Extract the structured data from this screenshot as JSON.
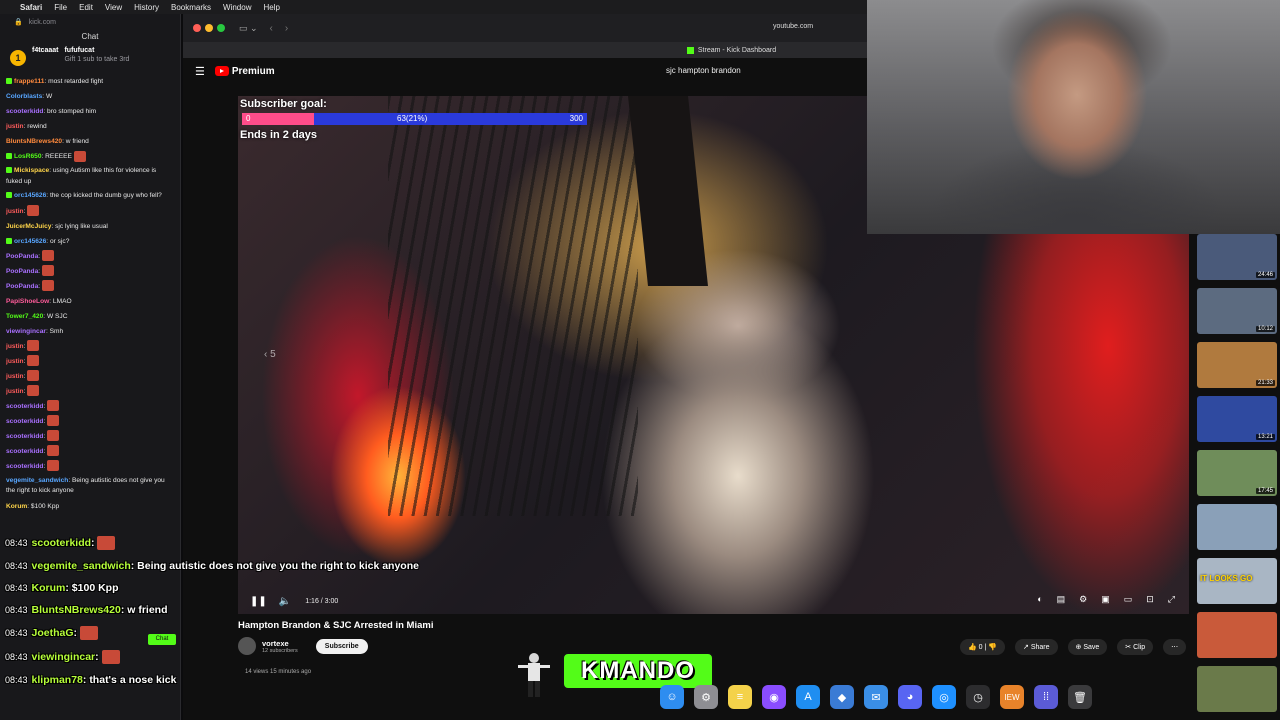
{
  "menubar": {
    "app": "Safari",
    "items": [
      "File",
      "Edit",
      "View",
      "History",
      "Bookmarks",
      "Window",
      "Help"
    ]
  },
  "chat": {
    "url": "kick.com",
    "title": "Chat",
    "gift": {
      "user": "f4tcaaat",
      "badge_user": "fufufucat",
      "count": "1",
      "note": "Gift 1 sub to take 3rd"
    },
    "messages": [
      {
        "user": "frappe111",
        "text": "most retarded fight",
        "color": "#ff8a3d",
        "badge": true
      },
      {
        "user": "Colorblasts",
        "text": "W",
        "color": "#58a6ff"
      },
      {
        "user": "scooterkidd",
        "text": "bro stomped him",
        "color": "#a970ff"
      },
      {
        "user": "justin",
        "text": "rewind",
        "color": "#ff5c5c"
      },
      {
        "user": "BluntsNBrews420",
        "text": "w friend",
        "color": "#ff8a3d"
      },
      {
        "user": "LosR650",
        "text": "REEEEE",
        "color": "#53fc18",
        "badge": true,
        "emote": true
      },
      {
        "user": "Mickispace",
        "text": "using Autism like this for violence is fuked up",
        "color": "#ffd54a",
        "badge": true,
        "two": true
      },
      {
        "user": "orc145626",
        "text": "the cop kicked the dumb guy who fell?",
        "color": "#58a6ff",
        "badge": true,
        "two": true
      },
      {
        "user": "justin",
        "text": "",
        "color": "#ff5c5c",
        "emote": true
      },
      {
        "user": "JuicerMcJuicy",
        "text": "sjc lying like usual",
        "color": "#ffd54a"
      },
      {
        "user": "orc145626",
        "text": "or sjc?",
        "color": "#58a6ff",
        "badge": true
      },
      {
        "user": "PooPanda",
        "text": "",
        "color": "#a970ff",
        "emote": true
      },
      {
        "user": "PooPanda",
        "text": "",
        "color": "#a970ff",
        "emote": true
      },
      {
        "user": "PooPanda",
        "text": "",
        "color": "#a970ff",
        "emote": true
      },
      {
        "user": "PapiShoeLow",
        "text": "LMAO",
        "color": "#ff5c9a"
      },
      {
        "user": "Tower7_420",
        "text": "W SJC",
        "color": "#53fc18"
      },
      {
        "user": "viewingincar",
        "text": "Smh",
        "color": "#a970ff"
      },
      {
        "user": "justin",
        "text": "",
        "color": "#ff5c5c",
        "emote": true
      },
      {
        "user": "justin",
        "text": "",
        "color": "#ff5c5c",
        "emote": true
      },
      {
        "user": "justin",
        "text": "",
        "color": "#ff5c5c",
        "emote": true
      },
      {
        "user": "justin",
        "text": "",
        "color": "#ff5c5c",
        "emote": true
      },
      {
        "user": "scooterkidd",
        "text": "",
        "color": "#a970ff",
        "emote": true
      },
      {
        "user": "scooterkidd",
        "text": "",
        "color": "#a970ff",
        "emote": true
      },
      {
        "user": "scooterkidd",
        "text": "",
        "color": "#a970ff",
        "emote": true
      },
      {
        "user": "scooterkidd",
        "text": "",
        "color": "#a970ff",
        "emote": true
      },
      {
        "user": "scooterkidd",
        "text": "",
        "color": "#a970ff",
        "emote": true
      },
      {
        "user": "vegemite_sandwich",
        "text": "Being autistic does not give you the right to kick anyone",
        "color": "#58a6ff",
        "two": true
      },
      {
        "user": "Korum",
        "text": "$100 Kpp",
        "color": "#ffd54a"
      }
    ]
  },
  "browser": {
    "url": "youtube.com",
    "tab_title": "Stream - Kick Dashboard",
    "yt_brand": "Premium",
    "search_query": "sjc hampton brandon"
  },
  "video": {
    "goal": {
      "title": "Subscriber goal:",
      "min": "0",
      "current": "63(21%)",
      "max": "300",
      "fill_fraction": 0.21,
      "ends": "Ends in 2 days"
    },
    "seek_hint": "‹ 5",
    "time": "1:16 / 3:00",
    "progress_fraction": 0.422,
    "title": "Hampton Brandon & SJC Arrested in Miami",
    "channel": "vortexe",
    "subscribers": "12 subscribers",
    "subscribe_label": "Subscribe",
    "likes": "0",
    "share": "Share",
    "save": "Save",
    "clip": "Clip",
    "views": "14 views  15 minutes ago"
  },
  "sidebar_thumbs": [
    {
      "dur": "24:46",
      "color": "#4a5a7a"
    },
    {
      "dur": "10:12",
      "color": "#5c6b80"
    },
    {
      "dur": "21:33",
      "color": "#b07a3e"
    },
    {
      "dur": "13:21",
      "color": "#2f4aa0"
    },
    {
      "dur": "17:45",
      "color": "#6f8d5a"
    },
    {
      "dur": "",
      "color": "#8aa0b8"
    },
    {
      "dur": "",
      "color": "#a9b6c4",
      "text": "IT LOOKS GO"
    },
    {
      "dur": "",
      "color": "#c95a3a"
    },
    {
      "dur": "",
      "color": "#6a7a4a"
    }
  ],
  "overlay_chat": [
    {
      "time": "08:43",
      "user": "scooterkidd",
      "text": "",
      "emote": true
    },
    {
      "time": "08:43",
      "user": "vegemite_sandwich",
      "text": "Being autistic does not give you the right to kick anyone"
    },
    {
      "time": "08:43",
      "user": "Korum",
      "text": "$100 Kpp"
    },
    {
      "time": "08:43",
      "user": "BluntsNBrews420",
      "text": "w friend"
    },
    {
      "time": "08:43",
      "user": "JoethaG",
      "text": "",
      "emote": true
    },
    {
      "time": "08:43",
      "user": "viewingincar",
      "text": "",
      "emote": true
    },
    {
      "time": "08:43",
      "user": "klipman78",
      "text": "that's a nose kick"
    }
  ],
  "kick_chat_button": "Chat",
  "mando_logo": "KMANDO",
  "dock": [
    {
      "name": "finder",
      "color": "#2e8df0",
      "glyph": "☺"
    },
    {
      "name": "settings",
      "color": "#8e8e93",
      "glyph": "⚙"
    },
    {
      "name": "notes",
      "color": "#f4d24a",
      "glyph": "≡"
    },
    {
      "name": "app-purple",
      "color": "#8a4dff",
      "glyph": "◉"
    },
    {
      "name": "app-store",
      "color": "#1f8ef1",
      "glyph": "A"
    },
    {
      "name": "app-blue",
      "color": "#3a7bd5",
      "glyph": "◆"
    },
    {
      "name": "mail",
      "color": "#3a8ee6",
      "glyph": "✉"
    },
    {
      "name": "discord",
      "color": "#5865f2",
      "glyph": "◕"
    },
    {
      "name": "safari",
      "color": "#1e90ff",
      "glyph": "◎"
    },
    {
      "name": "clock",
      "color": "#2c2c2e",
      "glyph": "◷"
    },
    {
      "name": "app-orange",
      "color": "#e8832a",
      "glyph": "IEW"
    },
    {
      "name": "launchpad",
      "color": "#5b5bd6",
      "glyph": "⁞⁞"
    },
    {
      "name": "trash",
      "color": "#3a3a3c",
      "glyph": "🗑"
    }
  ]
}
